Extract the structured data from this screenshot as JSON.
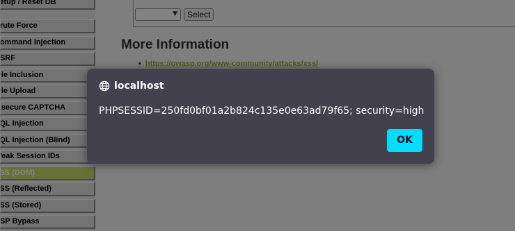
{
  "sidebar": {
    "items": [
      {
        "label": "Setup / Reset DB",
        "selected": false
      },
      {
        "label": "Brute Force",
        "selected": false
      },
      {
        "label": "Command Injection",
        "selected": false
      },
      {
        "label": "CSRF",
        "selected": false
      },
      {
        "label": "File Inclusion",
        "selected": false
      },
      {
        "label": "File Upload",
        "selected": false
      },
      {
        "label": "Insecure CAPTCHA",
        "selected": false
      },
      {
        "label": "SQL Injection",
        "selected": false
      },
      {
        "label": "SQL Injection (Blind)",
        "selected": false
      },
      {
        "label": "Weak Session IDs",
        "selected": false
      },
      {
        "label": "XSS (DOM)",
        "selected": true
      },
      {
        "label": "XSS (Reflected)",
        "selected": false
      },
      {
        "label": "XSS (Stored)",
        "selected": false
      },
      {
        "label": "CSP Bypass",
        "selected": false
      }
    ]
  },
  "main": {
    "select_button_label": "Select",
    "more_info_heading": "More Information",
    "links": [
      "https://owasp.org/www-community/attacks/xss/"
    ]
  },
  "dialog": {
    "title": "localhost",
    "message": "PHPSESSID=250fd0bf01a2b824c135e0e63ad79f65; security=high",
    "ok_label": "OK"
  },
  "colors": {
    "dialog_background": "#42414d",
    "ok_button": "#00ddff",
    "selected_menu": "#c3d96a",
    "link": "#8cb42e"
  },
  "icons": {
    "dialog_origin": "globe-icon",
    "dropdown": "chevron-down-icon"
  }
}
